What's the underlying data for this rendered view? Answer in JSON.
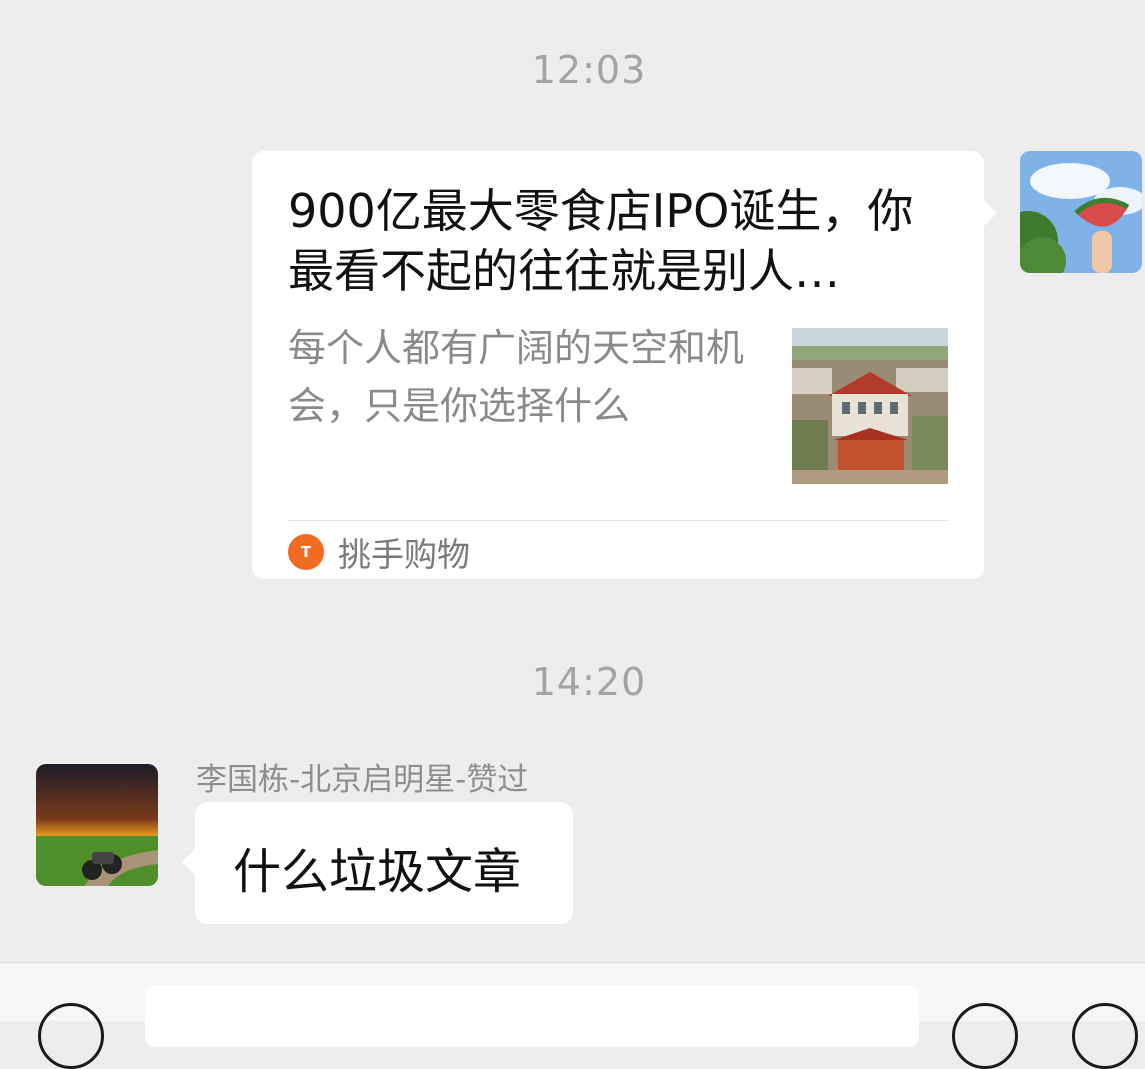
{
  "chat": {
    "timestamp_1": "12:03",
    "timestamp_2": "14:20",
    "link_card": {
      "title": "900亿最大零食店IPO诞生，你最看不起的往往就是别人…",
      "description": "每个人都有广阔的天空和机会，只是你选择什么",
      "source_name": "挑手购物"
    },
    "incoming": {
      "sender": "李国栋-北京启明星-赞过",
      "text": "什么垃圾文章"
    }
  },
  "colors": {
    "background": "#ededed",
    "bubble": "#ffffff",
    "source_logo": "#f36a22"
  },
  "icons": [
    "voice-icon",
    "emoji-icon",
    "plus-icon"
  ]
}
